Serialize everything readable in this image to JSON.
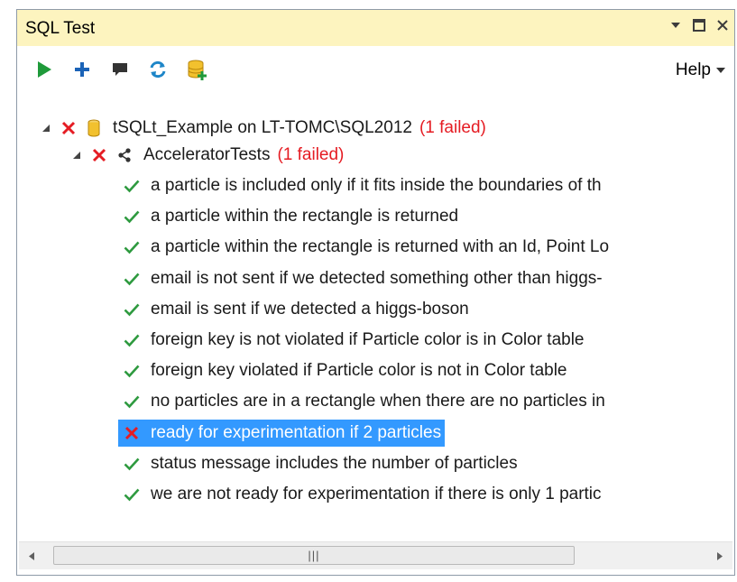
{
  "window": {
    "title": "SQL Test"
  },
  "toolbar": {
    "help_label": "Help"
  },
  "tree": {
    "database": {
      "label": "tSQLt_Example on LT-TOMC\\SQL2012",
      "failed": "(1 failed)"
    },
    "test_class": {
      "label": "AcceleratorTests",
      "failed": "(1 failed)"
    },
    "tests": [
      {
        "label": "a particle is included only if it fits inside the boundaries of th",
        "status": "passed"
      },
      {
        "label": "a particle within the rectangle is returned",
        "status": "passed"
      },
      {
        "label": "a particle within the rectangle is returned with an Id, Point Lo",
        "status": "passed"
      },
      {
        "label": "email is not sent if we detected something other than higgs-",
        "status": "passed"
      },
      {
        "label": "email is sent if we detected a higgs-boson",
        "status": "passed"
      },
      {
        "label": "foreign key is not violated if Particle color is in Color table",
        "status": "passed"
      },
      {
        "label": "foreign key violated if Particle color is not in Color table",
        "status": "passed"
      },
      {
        "label": "no particles are in a rectangle when there are no particles in",
        "status": "passed"
      },
      {
        "label": "ready for experimentation if 2 particles",
        "status": "failed"
      },
      {
        "label": "status message includes the number of particles",
        "status": "passed"
      },
      {
        "label": "we are not ready for experimentation if there is only 1 partic",
        "status": "passed"
      }
    ]
  },
  "colors": {
    "pass": "#2e9a3f",
    "fail": "#e51c23",
    "selection": "#3399ff",
    "title_bar": "#fdf4bf"
  }
}
